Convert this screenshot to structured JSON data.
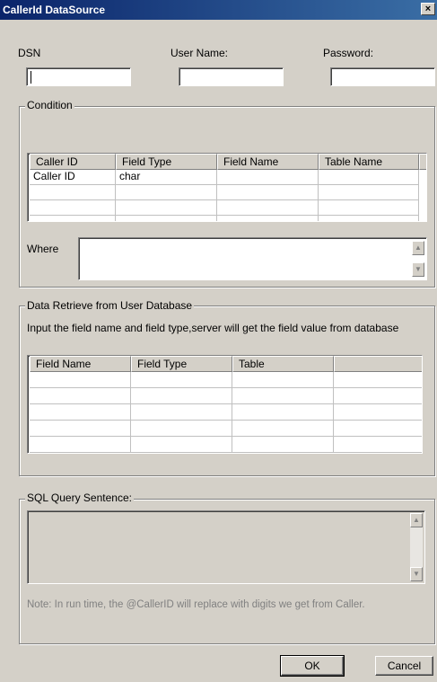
{
  "window": {
    "title": "CallerId DataSource",
    "close_glyph": "×"
  },
  "credentials": {
    "dsn_label": "DSN",
    "user_label": "User Name:",
    "password_label": "Password:",
    "dsn_value": "",
    "user_value": "",
    "password_value": ""
  },
  "condition": {
    "legend": "Condition",
    "columns": [
      "Caller ID",
      "Field Type",
      "Field Name",
      "Table Name"
    ],
    "rows": [
      [
        "Caller ID",
        "char",
        "",
        ""
      ]
    ],
    "where_label": "Where",
    "where_value": ""
  },
  "retrieve": {
    "legend": "Data Retrieve from User Database",
    "description": "Input the field name and field type,server will get the field value from database",
    "columns": [
      "Field Name",
      "Field Type",
      "Table",
      ""
    ]
  },
  "sql": {
    "legend": "SQL Query Sentence:",
    "value": "",
    "note": "Note: In run time, the @CallerID will replace with digits we get from Caller."
  },
  "buttons": {
    "ok": "OK",
    "cancel": "Cancel"
  },
  "icons": {
    "scroll_up": "up-arrow",
    "scroll_down": "down-arrow"
  }
}
